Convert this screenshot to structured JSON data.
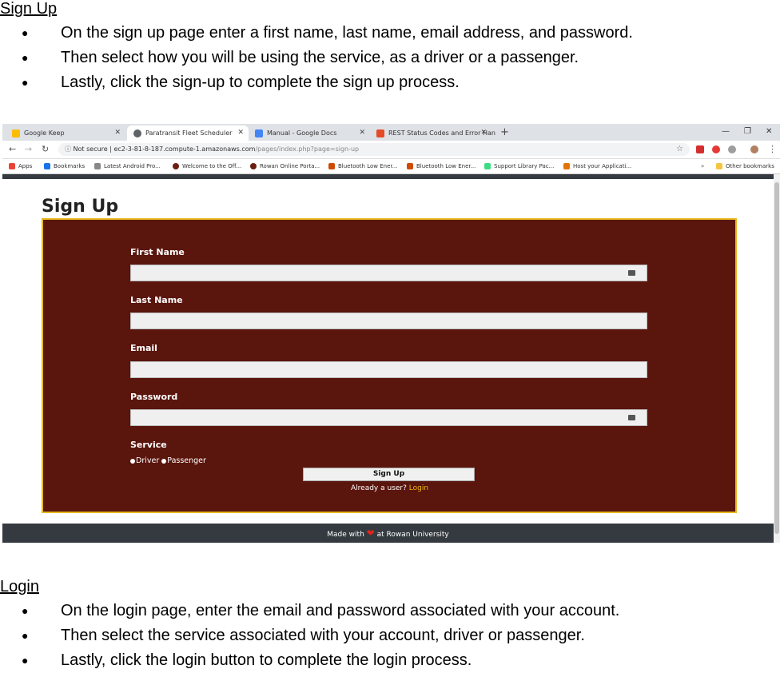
{
  "signup_section": {
    "heading": "Sign Up",
    "bullets": [
      "On the sign up page enter a first name, last name, email address, and password.",
      "Then select how you will be using the service, as a driver or a passenger.",
      "Lastly, click the sign-up to complete the sign up process."
    ]
  },
  "browser": {
    "tabs": [
      {
        "label": "Google Keep",
        "color": "#fbbc04"
      },
      {
        "label": "Paratransit Fleet Scheduler",
        "color": "#5f6368"
      },
      {
        "label": "Manual - Google Docs",
        "color": "#4285f4"
      },
      {
        "label": "REST Status Codes and Error Han",
        "color": "#e34c26"
      }
    ],
    "address": {
      "security": "Not secure",
      "host": "ec2-3-81-8-187.compute-1.amazonaws.com",
      "path": "/pages/index.php?page=sign-up"
    },
    "bookmarks": [
      {
        "label": "Apps",
        "color": "#ea4335"
      },
      {
        "label": "Bookmarks",
        "color": "#1a73e8"
      },
      {
        "label": "Latest Android Pro...",
        "color": "#888888"
      },
      {
        "label": "Welcome to the Off...",
        "color": "#6b1d0f"
      },
      {
        "label": "Rowan Online Porta...",
        "color": "#6b1d0f"
      },
      {
        "label": "Bluetooth Low Ener...",
        "color": "#d04a02"
      },
      {
        "label": "Bluetooth Low Ener...",
        "color": "#d04a02"
      },
      {
        "label": "Support Library Pac...",
        "color": "#3ddc84"
      },
      {
        "label": "Host your Applicati...",
        "color": "#e37400"
      }
    ],
    "other_bookmarks": "Other bookmarks"
  },
  "app": {
    "title": "Sign Up",
    "fields": [
      {
        "label": "First Name"
      },
      {
        "label": "Last Name"
      },
      {
        "label": "Email"
      },
      {
        "label": "Password"
      }
    ],
    "service_label": "Service",
    "service_options": [
      "Driver",
      "Passenger"
    ],
    "signup_button": "Sign Up",
    "already_user": "Already a user?",
    "login_link": "Login",
    "footer_prefix": "Made with",
    "footer_suffix": "at Rowan University",
    "colors": {
      "form_bg": "#5a150d",
      "form_border": "#e8b820",
      "link": "#f2b90f",
      "footer_bg": "#343a40"
    }
  },
  "login_section": {
    "heading": "Login",
    "bullets": [
      "On the login page, enter the email and password associated with your account.",
      "Then select the service associated with your account, driver or passenger.",
      "Lastly, click the login button to complete the login process."
    ]
  }
}
